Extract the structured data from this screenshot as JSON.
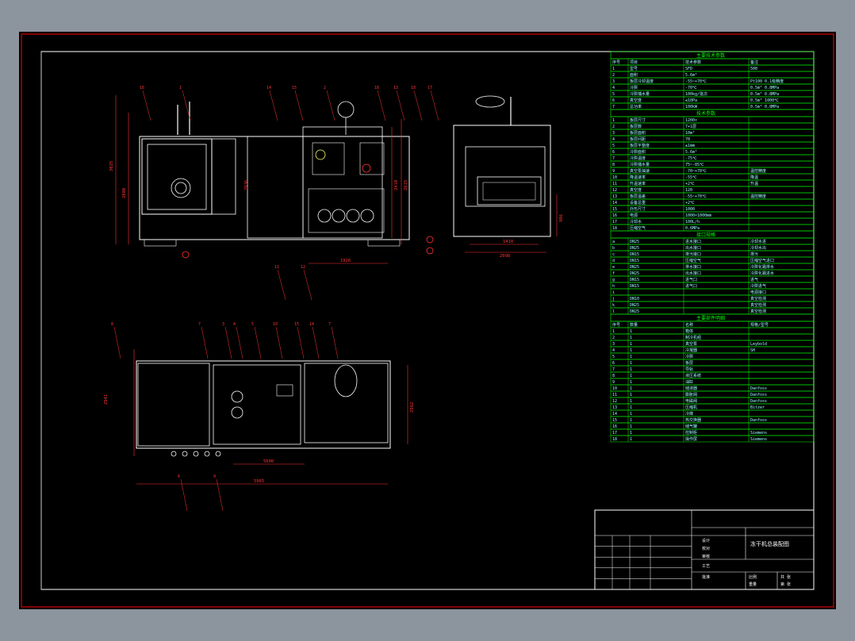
{
  "drawing": {
    "title": "冻干机总装配图",
    "colors": {
      "background": "#000000",
      "page": "#8c949e",
      "outer_frame": "#ff0000",
      "inner_frame": "#ffffff",
      "table_lines": "#00ff00",
      "table_text": "#99ffff",
      "callout": "#ff3333"
    },
    "views": [
      "front-view",
      "side-view",
      "top-view"
    ],
    "dimensions": {
      "front_height_left": "3025",
      "front_inner_height": "2880",
      "front_chamber_label": "2936",
      "front_right_height_a": "2410",
      "front_right_height_b": "2615",
      "front_bottom_width": "1926",
      "side_width_a": "1410",
      "side_width_b": "2098",
      "side_height": "986",
      "top_depth": "2941",
      "top_inner_depth": "2962",
      "top_width_a": "5600",
      "top_width_b": "5965"
    },
    "front_callouts": [
      "16",
      "1",
      "14",
      "15",
      "2",
      "18",
      "13",
      "18",
      "17",
      "11",
      "12"
    ],
    "top_callouts": [
      "8",
      "7",
      "3",
      "4",
      "5",
      "10",
      "15",
      "14",
      "7",
      "6",
      "9"
    ]
  },
  "tables": {
    "spec_header": "主要技术参数",
    "spec_cols": [
      "序号",
      "项目",
      "技术参数",
      "备注"
    ],
    "spec_rows": [
      [
        "1",
        "型号",
        "SFD",
        "500"
      ],
      [
        "2",
        "面积",
        "5.6m²",
        ""
      ],
      [
        "3",
        "板层冷却温度",
        "-55~+70℃",
        "Pt100 0.1级精度"
      ],
      [
        "4",
        "冷阱",
        "-70℃",
        "0.5m² 0.8MPa"
      ],
      [
        "5",
        "冷阱捕水量",
        "100kg/批次",
        "0.5m² 0.8MPa"
      ],
      [
        "6",
        "真空度",
        "≤10Pa",
        "0.5m² 1000℃"
      ],
      [
        "7",
        "总功率",
        "100kW",
        "0.5m² 0.8MPa"
      ]
    ],
    "perf_header": "技术参数",
    "perf_rows": [
      [
        "1",
        "板层尺寸",
        "1200×",
        "",
        ""
      ],
      [
        "2",
        "板层数",
        "7+1层",
        "",
        ""
      ],
      [
        "3",
        "板层面积",
        "10m²",
        "",
        ""
      ],
      [
        "4",
        "板层间距",
        "70",
        ""
      ],
      [
        "5",
        "板层平整度",
        "±1mm",
        "",
        ""
      ],
      [
        "6",
        "冷阱面积",
        "5.6m²",
        "",
        ""
      ],
      [
        "7",
        "冷阱温度",
        "-75℃",
        "",
        ""
      ],
      [
        "8",
        "冷阱捕水量",
        "75~-85℃",
        "",
        ""
      ],
      [
        "9",
        "真空泵抽速",
        "-70~+70℃",
        "温控精度"
      ],
      [
        "10",
        "降温速率",
        "-55℃",
        "降温"
      ],
      [
        "11",
        "升温速率",
        "+2℃",
        "升温"
      ],
      [
        "12",
        "真空度",
        "120",
        ""
      ],
      [
        "13",
        "板层温差",
        "-55~+70℃",
        "温控精度"
      ],
      [
        "14",
        "设备总重",
        "+2℃",
        ""
      ],
      [
        "15",
        "外形尺寸",
        "1000",
        ""
      ],
      [
        "16",
        "电源",
        "1000×1000mm",
        ""
      ],
      [
        "17",
        "冷却水",
        "100L/h",
        ""
      ],
      [
        "18",
        "压缩空气",
        "0.6MPa",
        ""
      ]
    ],
    "pipe_header": "接口规格",
    "pipe_rows": [
      [
        "a",
        "DN25",
        "进水接口",
        "冷却水进"
      ],
      [
        "b",
        "DN25",
        "出水接口",
        "冷却水出"
      ],
      [
        "c",
        "DN15",
        "排污接口",
        "排污"
      ],
      [
        "d",
        "DN15",
        "压缩空气",
        "压缩空气进口"
      ],
      [
        "e",
        "DN25",
        "排水接口",
        "冷阱化霜排水"
      ],
      [
        "f",
        "DN25",
        "出水接口",
        "冷阱化霜进水"
      ],
      [
        "g",
        "DN15",
        "进气口",
        "进气"
      ],
      [
        "h",
        "DN15",
        "进气口",
        "冷阱进气"
      ],
      [
        "i",
        "",
        "",
        "电源接口"
      ],
      [
        "j",
        "DN10",
        "",
        "真空检测"
      ],
      [
        "k",
        "DN25",
        "",
        "真空检测"
      ],
      [
        "l",
        "DN25",
        "",
        "真空检测"
      ]
    ],
    "parts_header": "主要部件明细",
    "parts_cols": [
      "序号",
      "数量",
      "名称",
      "规格/型号"
    ],
    "parts_rows": [
      [
        "1",
        "1",
        "箱体",
        ""
      ],
      [
        "2",
        "1",
        "制冷机组",
        ""
      ],
      [
        "3",
        "1",
        "真空泵",
        "Leybold"
      ],
      [
        "4",
        "1",
        "冷凝器",
        "SH"
      ],
      [
        "5",
        "1",
        "冷阱",
        ""
      ],
      [
        "6",
        "1",
        "板层",
        ""
      ],
      [
        "7",
        "1",
        "导轨",
        ""
      ],
      [
        "8",
        "1",
        "液压系统",
        ""
      ],
      [
        "9",
        "1",
        "油缸",
        ""
      ],
      [
        "10",
        "1",
        "储液器",
        "Danfoss"
      ],
      [
        "11",
        "1",
        "膨胀阀",
        "Danfoss"
      ],
      [
        "12",
        "1",
        "电磁阀",
        "Danfoss"
      ],
      [
        "13",
        "1",
        "压缩机",
        "Bitzer"
      ],
      [
        "14",
        "1",
        "冷媒",
        ""
      ],
      [
        "15",
        "1",
        "热交换器",
        "Danfoss"
      ],
      [
        "16",
        "1",
        "储气罐",
        ""
      ],
      [
        "17",
        "1",
        "控制柜",
        "Siemens"
      ],
      [
        "18",
        "1",
        "操作屏",
        "Siemens"
      ]
    ]
  },
  "title_block": {
    "title": "冻干机总装配图",
    "line1": "设计",
    "line2": "校对",
    "line3": "审核",
    "line4": "工艺",
    "line5": "批准",
    "scale_label": "比例",
    "sheet_label": "共 张",
    "cell_a": "重量",
    "cell_b": "第 张"
  }
}
